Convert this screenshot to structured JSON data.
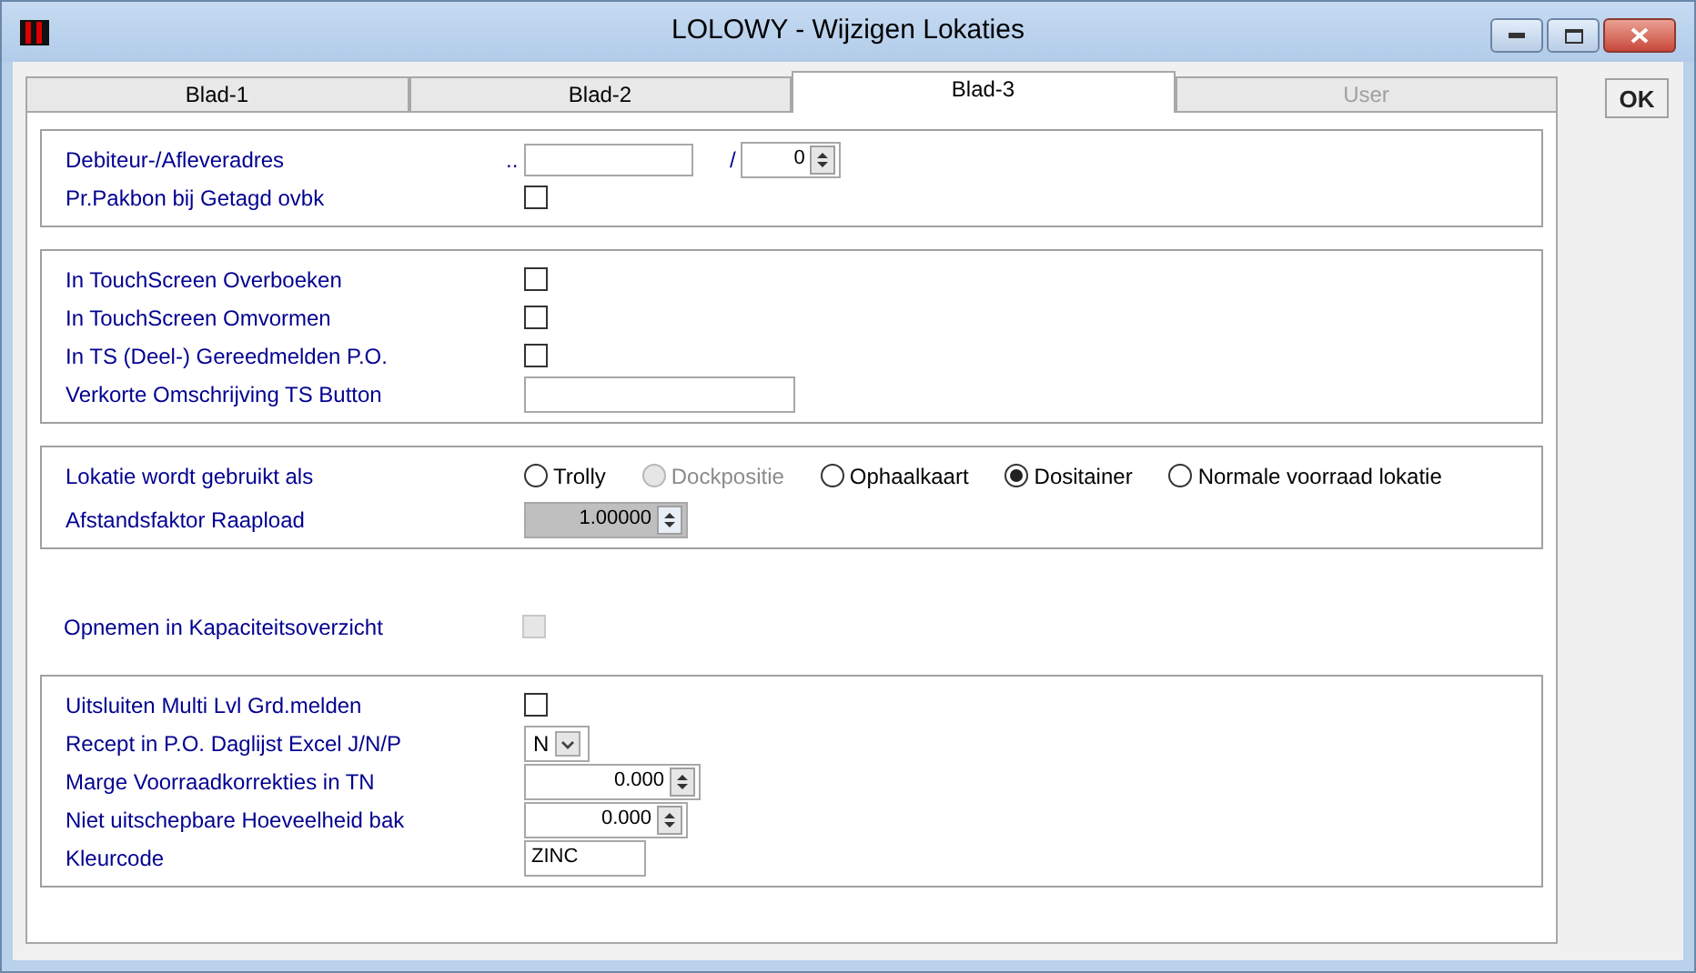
{
  "window": {
    "title": "LOLOWY - Wijzigen Lokaties"
  },
  "tabs": [
    {
      "label": "Blad-1",
      "selected": false,
      "disabled": false
    },
    {
      "label": "Blad-2",
      "selected": false,
      "disabled": false
    },
    {
      "label": "Blad-3",
      "selected": true,
      "disabled": false
    },
    {
      "label": "User",
      "selected": false,
      "disabled": true
    }
  ],
  "ok_button": {
    "label": "OK"
  },
  "sections": [
    {
      "framed": true,
      "rows": [
        {
          "kind": "debtor",
          "label": "Debiteur-/Afleveradres",
          "prefix": "..",
          "separator": "/",
          "spinner_value": "0"
        },
        {
          "kind": "checkbox",
          "label": "Pr.Pakbon bij Getagd ovbk",
          "checked": false,
          "disabled": false
        }
      ]
    },
    {
      "framed": true,
      "rows": [
        {
          "kind": "checkbox",
          "label": "In TouchScreen Overboeken",
          "checked": false,
          "disabled": false
        },
        {
          "kind": "checkbox",
          "label": "In TouchScreen Omvormen",
          "checked": false,
          "disabled": false
        },
        {
          "kind": "checkbox",
          "label": "In TS (Deel-) Gereedmelden P.O.",
          "checked": false,
          "disabled": false
        },
        {
          "kind": "text",
          "label": "Verkorte Omschrijving TS Button"
        }
      ]
    },
    {
      "framed": true,
      "rows": [
        {
          "kind": "radios",
          "label": "Lokatie wordt gebruikt als",
          "options": [
            {
              "label": "Trolly",
              "selected": false,
              "disabled": false
            },
            {
              "label": "Dockpositie",
              "selected": false,
              "disabled": true
            },
            {
              "label": "Ophaalkaart",
              "selected": false,
              "disabled": false
            },
            {
              "label": "Dositainer",
              "selected": true,
              "disabled": false
            },
            {
              "label": "Normale voorraad lokatie",
              "selected": false,
              "disabled": false
            }
          ]
        },
        {
          "kind": "spinner",
          "label": "Afstandsfaktor Raapload",
          "value": "1.00000",
          "disabled": true
        }
      ]
    },
    {
      "framed": false,
      "rows": [
        {
          "kind": "checkbox",
          "label": "Opnemen in Kapaciteitsoverzicht",
          "checked": false,
          "disabled": true
        }
      ]
    },
    {
      "framed": true,
      "rows": [
        {
          "kind": "checkbox",
          "label": "Uitsluiten Multi Lvl Grd.melden",
          "checked": false,
          "disabled": false
        },
        {
          "kind": "combo",
          "label": "Recept in P.O. Daglijst Excel J/N/P",
          "value": "N"
        },
        {
          "kind": "spinner",
          "label": "Marge Voorraadkorrekties in TN",
          "value": "0.000",
          "disabled": false
        },
        {
          "kind": "spinner",
          "label": "Niet uitschepbare Hoeveelheid bak",
          "value": "0.000",
          "disabled": false
        },
        {
          "kind": "text",
          "label": "Kleurcode",
          "value": "ZINC"
        }
      ]
    }
  ]
}
